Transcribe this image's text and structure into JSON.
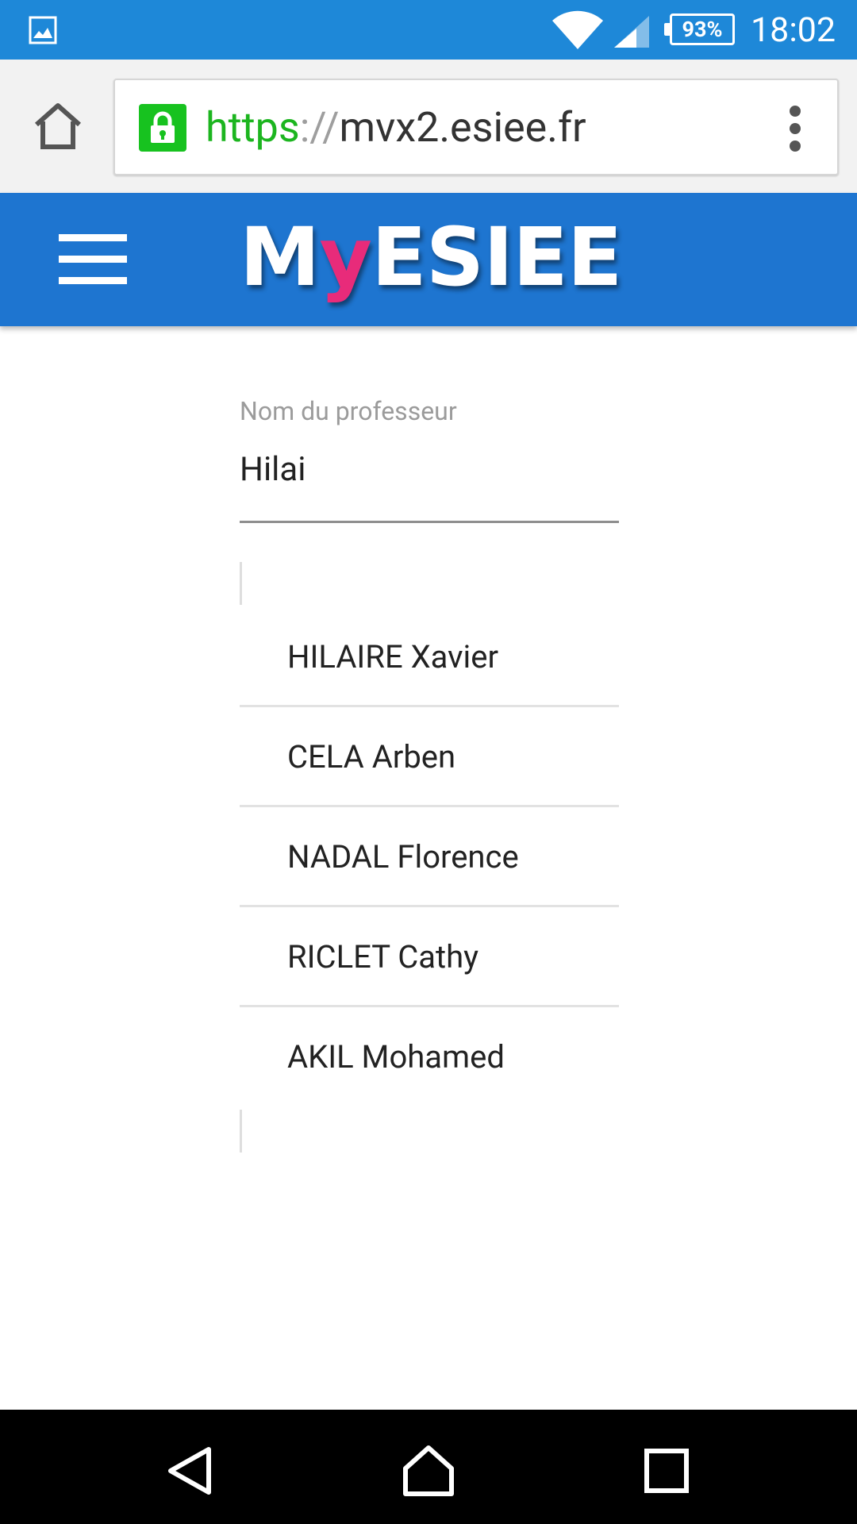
{
  "status_bar": {
    "battery_percent": "93%",
    "time": "18:02",
    "icons": [
      "gallery-icon",
      "wifi-icon",
      "signal-icon",
      "battery-icon"
    ]
  },
  "browser": {
    "url_scheme": "https",
    "url_separator": "://",
    "url_host": "mvx2.esiee.fr",
    "icons": [
      "home-icon",
      "lock-icon",
      "more-vert-icon"
    ]
  },
  "app_header": {
    "logo_part1": "M",
    "logo_accent": "y",
    "logo_part2": "ESIEE",
    "accent_color": "#e82b7a",
    "header_color": "#1e75d0"
  },
  "search": {
    "label": "Nom du professeur",
    "value": "Hilai"
  },
  "results": [
    "HILAIRE Xavier",
    "CELA Arben",
    "NADAL Florence",
    "RICLET Cathy",
    "AKIL Mohamed"
  ],
  "nav_bar": {
    "icons": [
      "back-icon",
      "home-icon",
      "recents-icon"
    ]
  }
}
